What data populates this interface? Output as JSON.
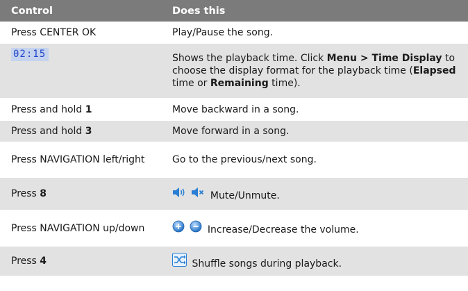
{
  "header": {
    "control": "Control",
    "does_this": "Does this"
  },
  "rows": [
    {
      "control": "Press CENTER OK",
      "does": "Play/Pause the song."
    },
    {
      "time_display": "02:15",
      "does_parts": [
        "Shows the playback time. Click ",
        "Menu > Time Display",
        " to choose the display format for the playback time (",
        "Elapsed",
        " time or ",
        "Remaining",
        " time)."
      ]
    },
    {
      "control_prefix": "Press and hold ",
      "control_key": "1",
      "does": "Move backward in a song."
    },
    {
      "control_prefix": "Press and hold ",
      "control_key": "3",
      "does": "Move forward in a song."
    },
    {
      "control": "Press NAVIGATION left/right",
      "does": "Go to the previous/next song."
    },
    {
      "control_prefix": "Press ",
      "control_key": "8",
      "does": "Mute/Unmute.",
      "icons": [
        "speaker-on-icon",
        "speaker-mute-icon"
      ]
    },
    {
      "control": "Press NAVIGATION up/down",
      "does": "Increase/Decrease the volume.",
      "icons": [
        "volume-up-icon",
        "volume-down-icon"
      ]
    },
    {
      "control_prefix": "Press ",
      "control_key": "4",
      "does": "Shuffle songs during playback.",
      "icons": [
        "shuffle-icon"
      ]
    }
  ],
  "colors": {
    "header_bg": "#7b7b7b",
    "alt_row_bg": "#e2e2e2",
    "time_display_bg": "#c5d3ee",
    "time_display_fg": "#1f44c9",
    "icon_blue": "#2a7fd4"
  }
}
